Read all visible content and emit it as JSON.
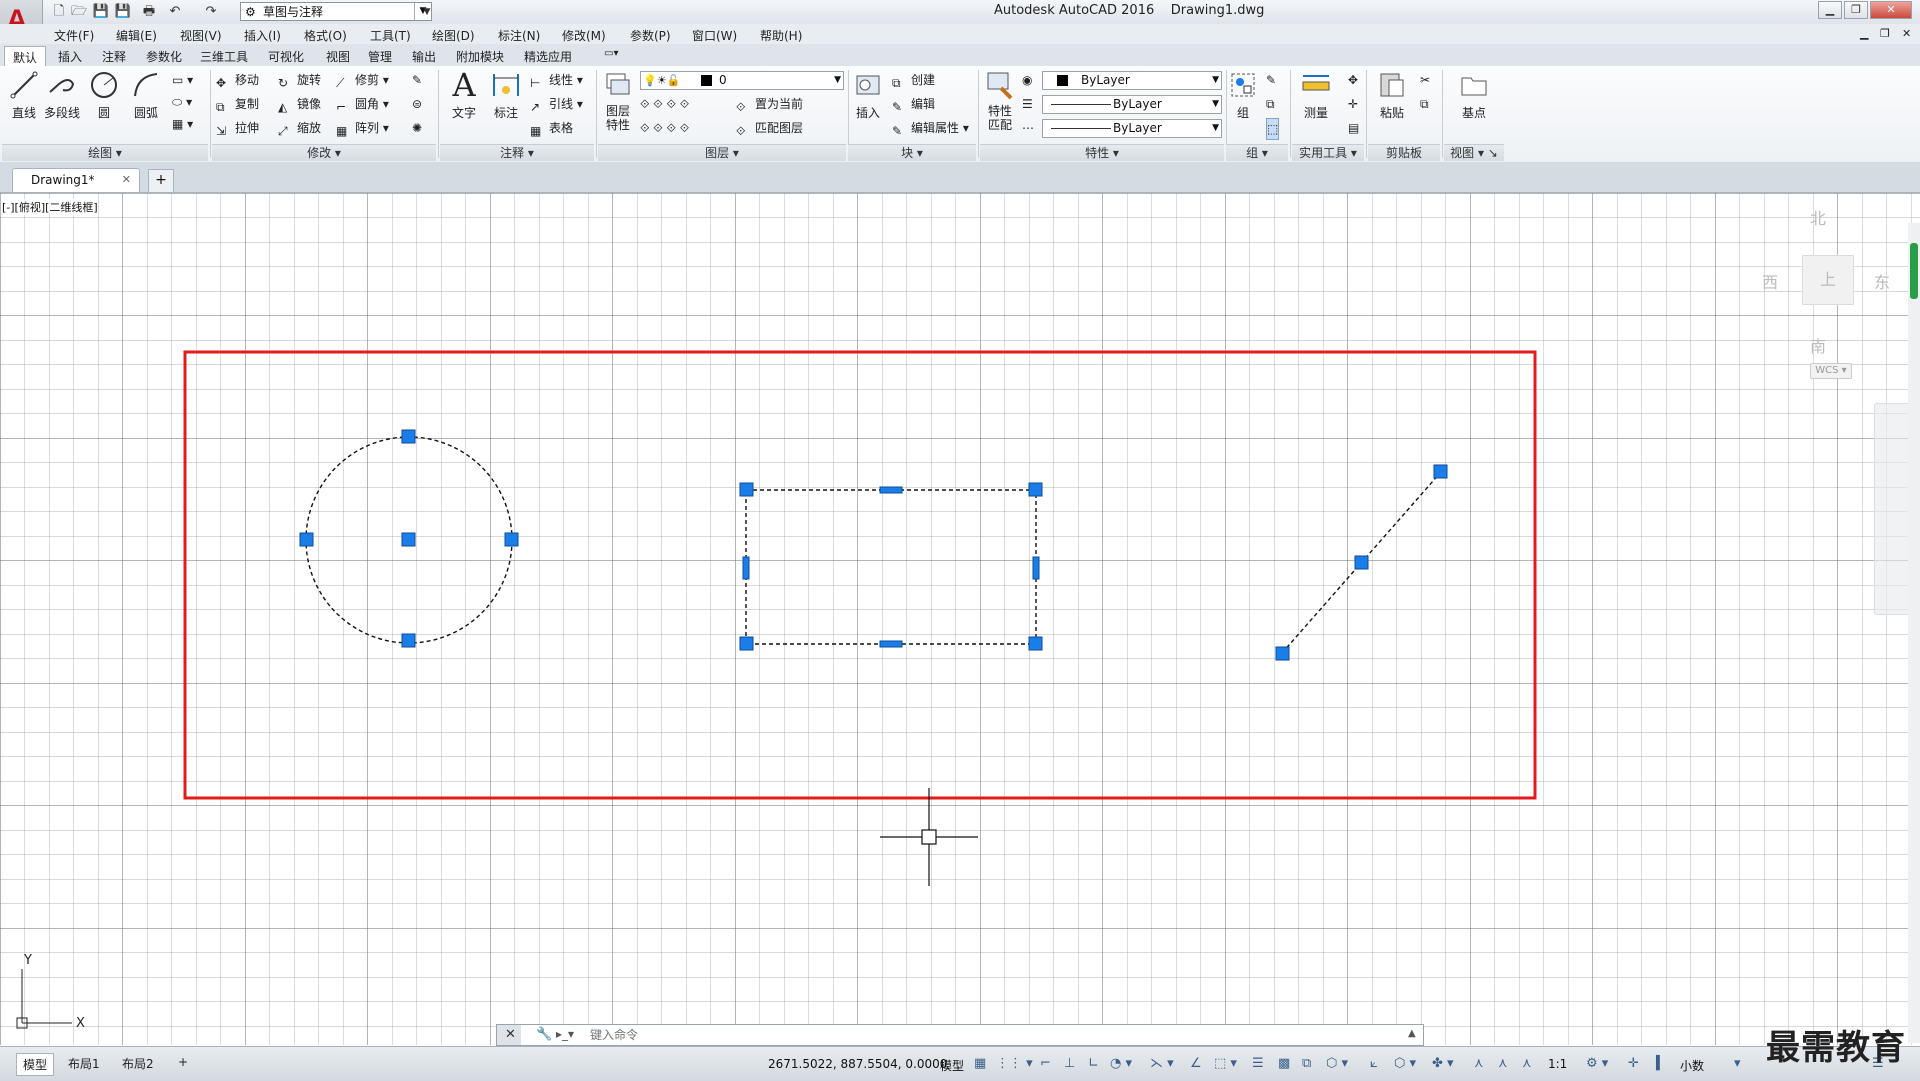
{
  "window": {
    "app_title": "Autodesk AutoCAD 2016",
    "file_name": "Drawing1.dwg",
    "workspace": "草图与注释"
  },
  "menu": [
    "文件(F)",
    "编辑(E)",
    "视图(V)",
    "插入(I)",
    "格式(O)",
    "工具(T)",
    "绘图(D)",
    "标注(N)",
    "修改(M)",
    "参数(P)",
    "窗口(W)",
    "帮助(H)"
  ],
  "ribbon_tabs": [
    "默认",
    "插入",
    "注释",
    "参数化",
    "三维工具",
    "可视化",
    "视图",
    "管理",
    "输出",
    "附加模块",
    "精选应用"
  ],
  "ribbon": {
    "draw": {
      "title": "绘图",
      "line": "直线",
      "polyline": "多段线",
      "circle": "圆",
      "arc": "圆弧"
    },
    "modify": {
      "title": "修改",
      "move": "移动",
      "rotate": "旋转",
      "trim": "修剪",
      "copy": "复制",
      "mirror": "镜像",
      "fillet": "圆角",
      "stretch": "拉伸",
      "scale": "缩放",
      "array": "阵列"
    },
    "annotation": {
      "title": "注释",
      "text": "文字",
      "dimension": "标注",
      "linear": "线性",
      "leader": "引线",
      "table": "表格"
    },
    "layers": {
      "title": "图层",
      "layer_properties_1": "图层",
      "layer_properties_2": "特性",
      "current_layer": "0",
      "set_current": "置为当前",
      "match_layer": "匹配图层"
    },
    "block": {
      "title": "块",
      "insert": "插入",
      "create": "创建",
      "edit": "编辑",
      "edit_attributes": "编辑属性"
    },
    "properties": {
      "title": "特性",
      "match_1": "特性",
      "match_2": "匹配",
      "color": "ByLayer",
      "linetype": "ByLayer",
      "lineweight": "ByLayer"
    },
    "groups": {
      "title": "组",
      "group": "组"
    },
    "utilities": {
      "title": "实用工具",
      "measure": "测量"
    },
    "clipboard": {
      "title": "剪贴板",
      "paste": "粘贴"
    },
    "view": {
      "title": "视图",
      "base": "基点"
    }
  },
  "doc_tab": {
    "name": "Drawing1*"
  },
  "viewport": {
    "label": "[-][俯视][二维线框]",
    "viewcube": {
      "north": "北",
      "south": "南",
      "east": "东",
      "west": "西",
      "top": "上"
    },
    "wcs": "WCS"
  },
  "command": {
    "placeholder": "键入命令"
  },
  "status": {
    "layout_tabs": [
      "模型",
      "布局1",
      "布局2"
    ],
    "coords": "2671.5022, 887.5504, 0.0000",
    "model": "模型",
    "scale": "1:1",
    "units": "小数"
  },
  "watermark": "最需教育",
  "colors": {
    "selection_red": "#e31b1b",
    "grip_blue": "#1a7de8",
    "grid_line": "#9a9a9a",
    "brand": "#c8141e"
  },
  "icons": [
    "autocad-logo-icon",
    "new-icon",
    "open-icon",
    "save-icon",
    "saveas-icon",
    "print-icon",
    "undo-icon",
    "redo-icon",
    "gear-icon",
    "minimize-icon",
    "restore-icon",
    "close-icon",
    "crosshair-cursor-icon",
    "ucs-icon"
  ]
}
